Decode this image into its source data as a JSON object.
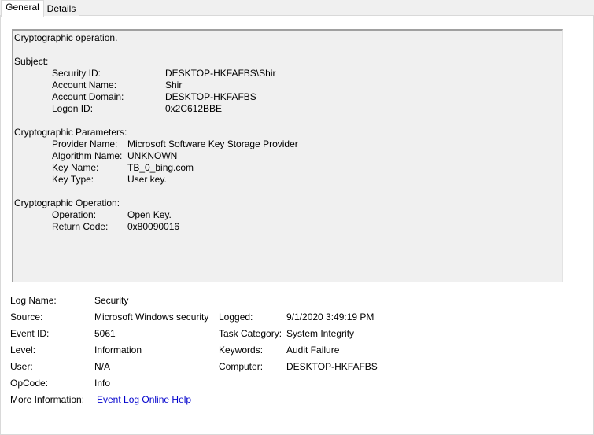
{
  "tabs": {
    "general": "General",
    "details": "Details"
  },
  "description": {
    "headline": "Cryptographic operation.",
    "subject": {
      "header": "Subject:",
      "security_id_label": "Security ID:",
      "security_id": "DESKTOP-HKFAFBS\\Shir",
      "account_name_label": "Account Name:",
      "account_name": "Shir",
      "account_domain_label": "Account Domain:",
      "account_domain": "DESKTOP-HKFAFBS",
      "logon_id_label": "Logon ID:",
      "logon_id": "0x2C612BBE"
    },
    "params": {
      "header": "Cryptographic Parameters:",
      "provider_label": "Provider Name:",
      "provider": "Microsoft Software Key Storage Provider",
      "algorithm_label": "Algorithm Name:",
      "algorithm": "UNKNOWN",
      "key_name_label": "Key Name:",
      "key_name": "TB_0_bing.com",
      "key_type_label": "Key Type:",
      "key_type": "User key."
    },
    "operation": {
      "header": "Cryptographic Operation:",
      "operation_label": "Operation:",
      "operation": "Open Key.",
      "return_code_label": "Return Code:",
      "return_code": "0x80090016"
    }
  },
  "properties": {
    "log_name_label": "Log Name:",
    "log_name": "Security",
    "source_label": "Source:",
    "source": "Microsoft Windows security",
    "logged_label": "Logged:",
    "logged": "9/1/2020 3:49:19 PM",
    "event_id_label": "Event ID:",
    "event_id": "5061",
    "task_category_label": "Task Category:",
    "task_category": "System Integrity",
    "level_label": "Level:",
    "level": "Information",
    "keywords_label": "Keywords:",
    "keywords": "Audit Failure",
    "user_label": "User:",
    "user": "N/A",
    "computer_label": "Computer:",
    "computer": "DESKTOP-HKFAFBS",
    "opcode_label": "OpCode:",
    "opcode": "Info",
    "more_info_label": "More Information:",
    "more_info_link": "Event Log Online Help"
  }
}
